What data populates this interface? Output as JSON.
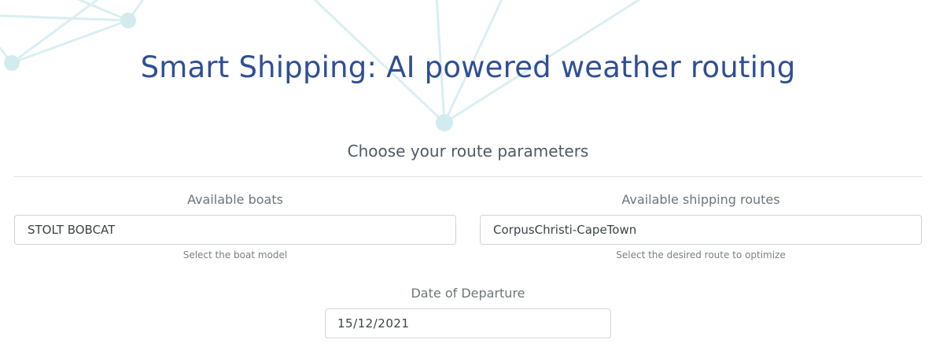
{
  "header": {
    "title": "Smart Shipping: AI powered weather routing"
  },
  "form": {
    "heading": "Choose your route parameters",
    "boats": {
      "label": "Available boats",
      "selected": "STOLT BOBCAT",
      "help": "Select the boat model"
    },
    "routes": {
      "label": "Available shipping routes",
      "selected": "CorpusChristi-CapeTown",
      "help": "Select the desired route to optimize"
    },
    "departure": {
      "label": "Date of Departure",
      "value": "15/12/2021"
    }
  },
  "colors": {
    "title": "#2f4f94",
    "network": "#d6eef0"
  }
}
